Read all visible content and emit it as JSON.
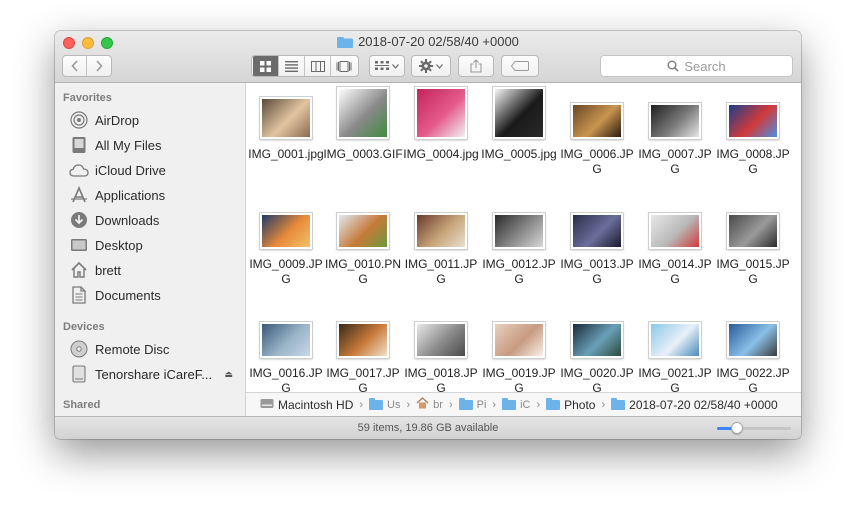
{
  "window": {
    "title": "2018-07-20 02/58/40 +0000"
  },
  "toolbar": {
    "back_icon": "chevron-left-icon",
    "forward_icon": "chevron-right-icon",
    "view_modes": [
      "icon-view",
      "list-view",
      "column-view",
      "cover-flow-view"
    ],
    "active_view": "icon-view",
    "search_placeholder": "Search"
  },
  "sidebar": {
    "favorites_heading": "Favorites",
    "favorites": [
      {
        "label": "AirDrop",
        "icon": "airdrop-icon"
      },
      {
        "label": "All My Files",
        "icon": "all-files-icon"
      },
      {
        "label": "iCloud Drive",
        "icon": "cloud-icon"
      },
      {
        "label": "Applications",
        "icon": "applications-icon"
      },
      {
        "label": "Downloads",
        "icon": "downloads-icon"
      },
      {
        "label": "Desktop",
        "icon": "desktop-icon"
      },
      {
        "label": "brett",
        "icon": "home-icon"
      },
      {
        "label": "Documents",
        "icon": "documents-icon"
      }
    ],
    "devices_heading": "Devices",
    "devices": [
      {
        "label": "Remote Disc",
        "icon": "disc-icon"
      },
      {
        "label": "Tenorshare iCareF...",
        "icon": "drive-icon",
        "eject": "⏏"
      }
    ],
    "shared_heading": "Shared"
  },
  "files": [
    {
      "name": "IMG_0001.jpg",
      "colors": [
        "#5a4a3a",
        "#e2c5a0",
        "#8a6a50"
      ],
      "shape": "portrait-wide"
    },
    {
      "name": "IMG_0003.GIF",
      "colors": [
        "#ffffff",
        "#8a8a8a",
        "#3f8b3f"
      ],
      "shape": "square"
    },
    {
      "name": "IMG_0004.jpg",
      "colors": [
        "#c2245c",
        "#e45a8b",
        "#f2f2f2"
      ],
      "shape": "square"
    },
    {
      "name": "IMG_0005.jpg",
      "colors": [
        "#f5f5f5",
        "#1a1a1a",
        "#2a2a2a"
      ],
      "shape": "square"
    },
    {
      "name": "IMG_0006.JPG",
      "colors": [
        "#6a4628",
        "#c8954f",
        "#2a1a10"
      ],
      "shape": "wide"
    },
    {
      "name": "IMG_0007.JPG",
      "colors": [
        "#202020",
        "#7a7a7a",
        "#e8e8e8"
      ],
      "shape": "wide"
    },
    {
      "name": "IMG_0008.JPG",
      "colors": [
        "#1a3f8a",
        "#d33a3a",
        "#4a90e2"
      ],
      "shape": "wide"
    },
    {
      "name": "IMG_0009.JPG",
      "colors": [
        "#1e3a6a",
        "#e88a3a",
        "#f2c26a"
      ],
      "shape": "wide"
    },
    {
      "name": "IMG_0010.PNG",
      "colors": [
        "#dfe7ef",
        "#c77a3a",
        "#6a9a3a"
      ],
      "shape": "wide"
    },
    {
      "name": "IMG_0011.JPG",
      "colors": [
        "#6a3a2a",
        "#c8a57a",
        "#e8e0d0"
      ],
      "shape": "wide"
    },
    {
      "name": "IMG_0012.JPG",
      "colors": [
        "#2a2a2a",
        "#8a8a8a",
        "#d8d8d8"
      ],
      "shape": "wide"
    },
    {
      "name": "IMG_0013.JPG",
      "colors": [
        "#2a2e4a",
        "#6a6e9a",
        "#1a1a2a"
      ],
      "shape": "wide"
    },
    {
      "name": "IMG_0014.JPG",
      "colors": [
        "#e8e8e8",
        "#b8b8b8",
        "#cf3a3a"
      ],
      "shape": "wide"
    },
    {
      "name": "IMG_0015.JPG",
      "colors": [
        "#4a4a4a",
        "#9a9a9a",
        "#2a2a2a"
      ],
      "shape": "wide"
    },
    {
      "name": "IMG_0016.JPG",
      "colors": [
        "#3a5a7a",
        "#9ab4c8",
        "#c8d8e8"
      ],
      "shape": "wide"
    },
    {
      "name": "IMG_0017.JPG",
      "colors": [
        "#3a2a1a",
        "#c87a3a",
        "#f2e2c8"
      ],
      "shape": "wide"
    },
    {
      "name": "IMG_0018.JPG",
      "colors": [
        "#e8e8e8",
        "#8a8a8a",
        "#4a4a4a"
      ],
      "shape": "wide"
    },
    {
      "name": "IMG_0019.JPG",
      "colors": [
        "#e8d0c0",
        "#c89a80",
        "#f8f0e8"
      ],
      "shape": "wide"
    },
    {
      "name": "IMG_0020.JPG",
      "colors": [
        "#1a2a3a",
        "#6aa0b8",
        "#2a4a3a"
      ],
      "shape": "wide"
    },
    {
      "name": "IMG_0021.JPG",
      "colors": [
        "#8ac8e8",
        "#e8f0f8",
        "#4a8aba"
      ],
      "shape": "wide"
    },
    {
      "name": "IMG_0022.JPG",
      "colors": [
        "#2a5a9a",
        "#8ac0e8",
        "#3a3a3a"
      ],
      "shape": "wide"
    }
  ],
  "pathbar": [
    {
      "label": "Macintosh HD",
      "icon": "hard-drive-icon"
    },
    {
      "label": "Us",
      "icon": "folder-icon"
    },
    {
      "label": "br",
      "icon": "home-icon"
    },
    {
      "label": "Pi",
      "icon": "folder-icon"
    },
    {
      "label": "iC",
      "icon": "folder-icon"
    },
    {
      "label": "Photo",
      "icon": "folder-icon"
    },
    {
      "label": "2018-07-20 02/58/40 +0000",
      "icon": "folder-icon"
    }
  ],
  "status": {
    "text": "59 items, 19.86 GB available",
    "icon_size_fraction": 0.27
  },
  "colors": {
    "accent": "#3b86f7",
    "folder": "#6cb3ea"
  }
}
